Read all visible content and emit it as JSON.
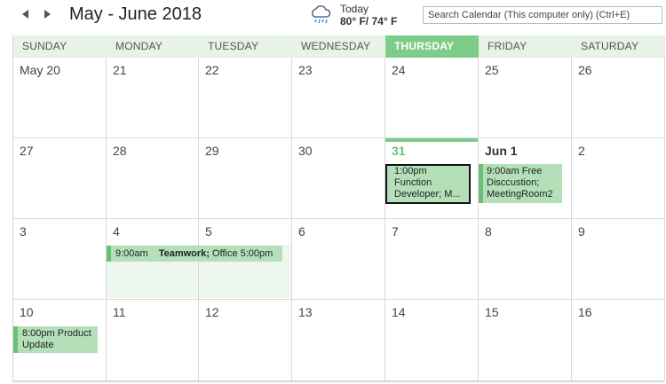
{
  "header": {
    "title": "May - June 2018",
    "prev_icon": "triangle-left",
    "next_icon": "triangle-right",
    "weather": {
      "label": "Today",
      "temp": "80° F/ 74° F",
      "icon": "rain-cloud"
    },
    "search_placeholder": "Search Calendar (This computer only) (Ctrl+E)"
  },
  "days": [
    "SUNDAY",
    "MONDAY",
    "TUESDAY",
    "WEDNESDAY",
    "THURSDAY",
    "FRIDAY",
    "SATURDAY"
  ],
  "weeks": [
    [
      "May 20",
      "21",
      "22",
      "23",
      "24",
      "25",
      "26"
    ],
    [
      "27",
      "28",
      "29",
      "30",
      "31",
      "Jun 1",
      "2"
    ],
    [
      "3",
      "4",
      "5",
      "6",
      "7",
      "8",
      "9"
    ],
    [
      "10",
      "11",
      "12",
      "13",
      "14",
      "15",
      "16"
    ]
  ],
  "events": {
    "function": {
      "line1": "1:00pm",
      "line2": "Function",
      "line3": "Developer; M..."
    },
    "free_discussion": {
      "line1": "9:00am Free",
      "line2": "Disccustion;",
      "line3": "MeetingRoom2"
    },
    "teamwork": {
      "start": "9:00am",
      "title": "Teamwork;",
      "location": "Office",
      "end": "5:00pm"
    },
    "product_update": {
      "line1": "8:00pm Product",
      "line2": "Update"
    }
  },
  "colors": {
    "accent": "#7dcc8a",
    "event_bg": "#b3e0b8",
    "header_bg": "#e6f3e6",
    "today_text": "#6cc27a"
  }
}
